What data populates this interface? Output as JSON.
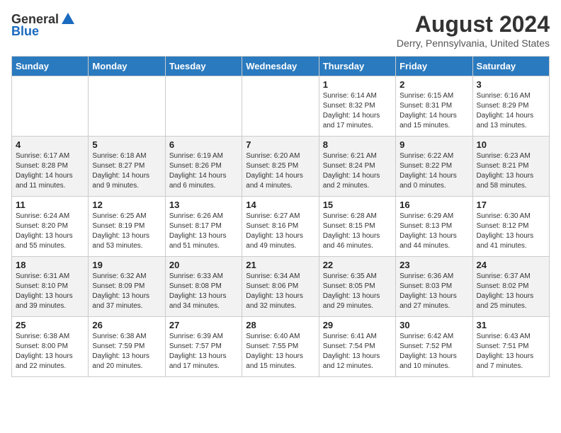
{
  "header": {
    "logo_line1": "General",
    "logo_line2": "Blue",
    "month_year": "August 2024",
    "location": "Derry, Pennsylvania, United States"
  },
  "weekdays": [
    "Sunday",
    "Monday",
    "Tuesday",
    "Wednesday",
    "Thursday",
    "Friday",
    "Saturday"
  ],
  "weeks": [
    [
      {
        "day": "",
        "info": ""
      },
      {
        "day": "",
        "info": ""
      },
      {
        "day": "",
        "info": ""
      },
      {
        "day": "",
        "info": ""
      },
      {
        "day": "1",
        "info": "Sunrise: 6:14 AM\nSunset: 8:32 PM\nDaylight: 14 hours\nand 17 minutes."
      },
      {
        "day": "2",
        "info": "Sunrise: 6:15 AM\nSunset: 8:31 PM\nDaylight: 14 hours\nand 15 minutes."
      },
      {
        "day": "3",
        "info": "Sunrise: 6:16 AM\nSunset: 8:29 PM\nDaylight: 14 hours\nand 13 minutes."
      }
    ],
    [
      {
        "day": "4",
        "info": "Sunrise: 6:17 AM\nSunset: 8:28 PM\nDaylight: 14 hours\nand 11 minutes."
      },
      {
        "day": "5",
        "info": "Sunrise: 6:18 AM\nSunset: 8:27 PM\nDaylight: 14 hours\nand 9 minutes."
      },
      {
        "day": "6",
        "info": "Sunrise: 6:19 AM\nSunset: 8:26 PM\nDaylight: 14 hours\nand 6 minutes."
      },
      {
        "day": "7",
        "info": "Sunrise: 6:20 AM\nSunset: 8:25 PM\nDaylight: 14 hours\nand 4 minutes."
      },
      {
        "day": "8",
        "info": "Sunrise: 6:21 AM\nSunset: 8:24 PM\nDaylight: 14 hours\nand 2 minutes."
      },
      {
        "day": "9",
        "info": "Sunrise: 6:22 AM\nSunset: 8:22 PM\nDaylight: 14 hours\nand 0 minutes."
      },
      {
        "day": "10",
        "info": "Sunrise: 6:23 AM\nSunset: 8:21 PM\nDaylight: 13 hours\nand 58 minutes."
      }
    ],
    [
      {
        "day": "11",
        "info": "Sunrise: 6:24 AM\nSunset: 8:20 PM\nDaylight: 13 hours\nand 55 minutes."
      },
      {
        "day": "12",
        "info": "Sunrise: 6:25 AM\nSunset: 8:19 PM\nDaylight: 13 hours\nand 53 minutes."
      },
      {
        "day": "13",
        "info": "Sunrise: 6:26 AM\nSunset: 8:17 PM\nDaylight: 13 hours\nand 51 minutes."
      },
      {
        "day": "14",
        "info": "Sunrise: 6:27 AM\nSunset: 8:16 PM\nDaylight: 13 hours\nand 49 minutes."
      },
      {
        "day": "15",
        "info": "Sunrise: 6:28 AM\nSunset: 8:15 PM\nDaylight: 13 hours\nand 46 minutes."
      },
      {
        "day": "16",
        "info": "Sunrise: 6:29 AM\nSunset: 8:13 PM\nDaylight: 13 hours\nand 44 minutes."
      },
      {
        "day": "17",
        "info": "Sunrise: 6:30 AM\nSunset: 8:12 PM\nDaylight: 13 hours\nand 41 minutes."
      }
    ],
    [
      {
        "day": "18",
        "info": "Sunrise: 6:31 AM\nSunset: 8:10 PM\nDaylight: 13 hours\nand 39 minutes."
      },
      {
        "day": "19",
        "info": "Sunrise: 6:32 AM\nSunset: 8:09 PM\nDaylight: 13 hours\nand 37 minutes."
      },
      {
        "day": "20",
        "info": "Sunrise: 6:33 AM\nSunset: 8:08 PM\nDaylight: 13 hours\nand 34 minutes."
      },
      {
        "day": "21",
        "info": "Sunrise: 6:34 AM\nSunset: 8:06 PM\nDaylight: 13 hours\nand 32 minutes."
      },
      {
        "day": "22",
        "info": "Sunrise: 6:35 AM\nSunset: 8:05 PM\nDaylight: 13 hours\nand 29 minutes."
      },
      {
        "day": "23",
        "info": "Sunrise: 6:36 AM\nSunset: 8:03 PM\nDaylight: 13 hours\nand 27 minutes."
      },
      {
        "day": "24",
        "info": "Sunrise: 6:37 AM\nSunset: 8:02 PM\nDaylight: 13 hours\nand 25 minutes."
      }
    ],
    [
      {
        "day": "25",
        "info": "Sunrise: 6:38 AM\nSunset: 8:00 PM\nDaylight: 13 hours\nand 22 minutes."
      },
      {
        "day": "26",
        "info": "Sunrise: 6:38 AM\nSunset: 7:59 PM\nDaylight: 13 hours\nand 20 minutes."
      },
      {
        "day": "27",
        "info": "Sunrise: 6:39 AM\nSunset: 7:57 PM\nDaylight: 13 hours\nand 17 minutes."
      },
      {
        "day": "28",
        "info": "Sunrise: 6:40 AM\nSunset: 7:55 PM\nDaylight: 13 hours\nand 15 minutes."
      },
      {
        "day": "29",
        "info": "Sunrise: 6:41 AM\nSunset: 7:54 PM\nDaylight: 13 hours\nand 12 minutes."
      },
      {
        "day": "30",
        "info": "Sunrise: 6:42 AM\nSunset: 7:52 PM\nDaylight: 13 hours\nand 10 minutes."
      },
      {
        "day": "31",
        "info": "Sunrise: 6:43 AM\nSunset: 7:51 PM\nDaylight: 13 hours\nand 7 minutes."
      }
    ]
  ]
}
